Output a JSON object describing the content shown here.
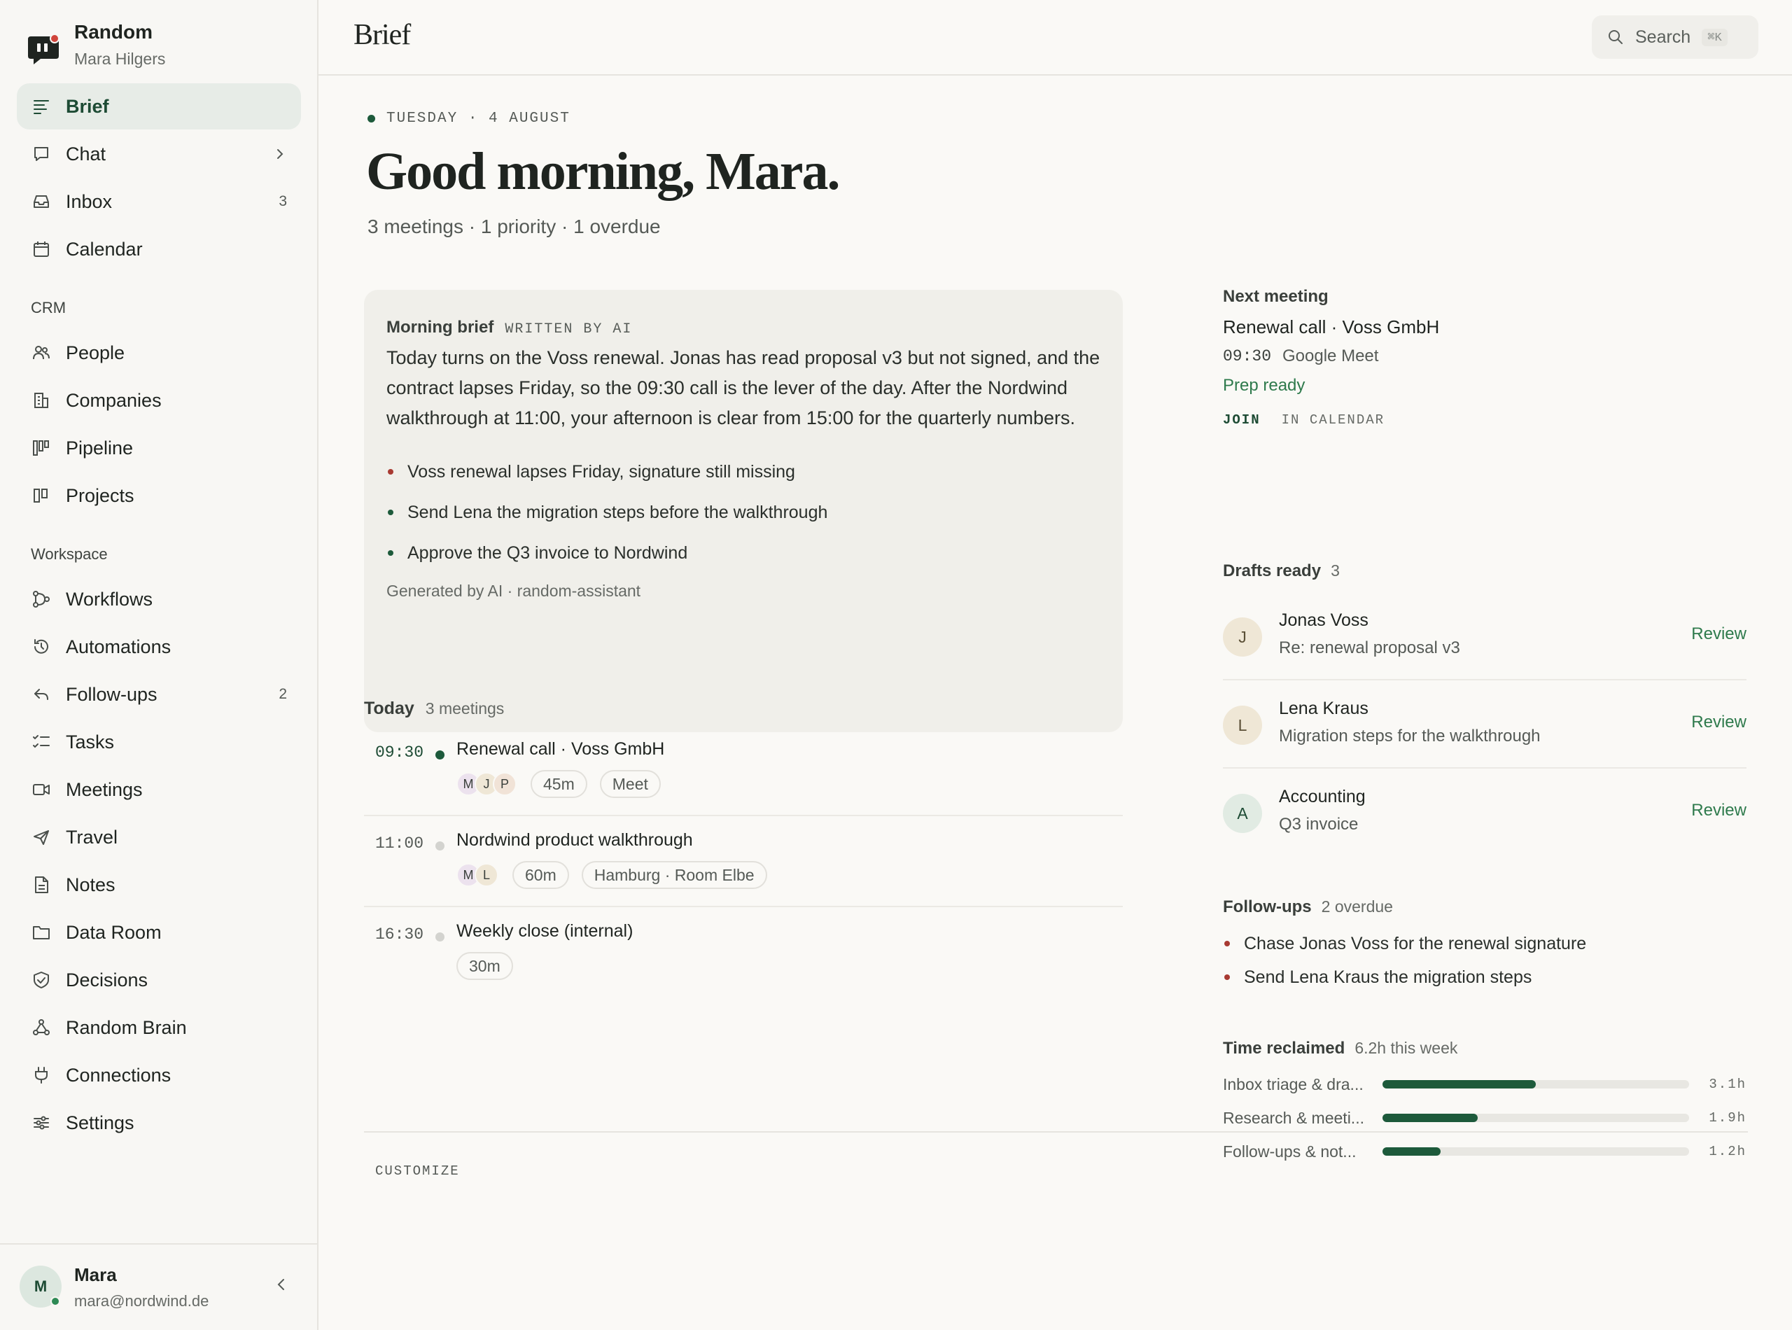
{
  "workspace": {
    "name": "Random",
    "user": "Mara Hilgers"
  },
  "nav": {
    "primary": [
      {
        "label": "Brief",
        "icon": "brief-icon",
        "active": true
      },
      {
        "label": "Chat",
        "icon": "chat-icon",
        "chevron": true
      },
      {
        "label": "Inbox",
        "icon": "inbox-icon",
        "count": "3"
      },
      {
        "label": "Calendar",
        "icon": "calendar-icon"
      }
    ],
    "crm_label": "CRM",
    "crm": [
      {
        "label": "People",
        "icon": "people-icon"
      },
      {
        "label": "Companies",
        "icon": "companies-icon"
      },
      {
        "label": "Pipeline",
        "icon": "pipeline-icon"
      },
      {
        "label": "Projects",
        "icon": "projects-icon"
      }
    ],
    "workspace_label": "Workspace",
    "workspace": [
      {
        "label": "Workflows",
        "icon": "workflows-icon"
      },
      {
        "label": "Automations",
        "icon": "automations-icon"
      },
      {
        "label": "Follow-ups",
        "icon": "follow-ups-icon",
        "count": "2"
      },
      {
        "label": "Tasks",
        "icon": "tasks-icon"
      },
      {
        "label": "Meetings",
        "icon": "meetings-icon"
      },
      {
        "label": "Travel",
        "icon": "travel-icon"
      },
      {
        "label": "Notes",
        "icon": "notes-icon"
      },
      {
        "label": "Data Room",
        "icon": "data-room-icon"
      },
      {
        "label": "Decisions",
        "icon": "decisions-icon"
      },
      {
        "label": "Random Brain",
        "icon": "brain-icon"
      },
      {
        "label": "Connections",
        "icon": "connections-icon"
      },
      {
        "label": "Settings",
        "icon": "settings-icon"
      }
    ]
  },
  "user_bar": {
    "initial": "M",
    "name": "Mara",
    "email": "mara@nordwind.de"
  },
  "header": {
    "title": "Brief",
    "search_label": "Search",
    "search_shortcut": "⌘K"
  },
  "greeting": {
    "dateline": "TUESDAY · 4 AUGUST",
    "title": "Good morning, Mara.",
    "summary": "3 meetings · 1 priority · 1 overdue"
  },
  "brief": {
    "title": "Morning brief",
    "tag": "WRITTEN BY AI",
    "body": "Today turns on the Voss renewal. Jonas has read proposal v3 but not signed, and the contract lapses Friday, so the 09:30 call is the lever of the day. After the Nordwind walkthrough at 11:00, your afternoon is clear from 15:00 for the quarterly numbers.",
    "items": [
      {
        "text": "Voss renewal lapses Friday, signature still missing",
        "color": "#a83a32"
      },
      {
        "text": "Send Lena the migration steps before the walkthrough",
        "color": "#1d5a3b"
      },
      {
        "text": "Approve the Q3 invoice to Nordwind",
        "color": "#1d5a3b"
      }
    ],
    "footer": "Generated by AI · random-assistant"
  },
  "today": {
    "title": "Today",
    "count": "3 meetings",
    "meetings": [
      {
        "time": "09:30",
        "title": "Renewal call · Voss GmbH",
        "attendees": [
          "M",
          "J",
          "P"
        ],
        "duration": "45m",
        "location": "Meet",
        "now": true
      },
      {
        "time": "11:00",
        "title": "Nordwind product walkthrough",
        "attendees": [
          "M",
          "L"
        ],
        "duration": "60m",
        "location": "Hamburg · Room Elbe"
      },
      {
        "time": "16:30",
        "title": "Weekly close (internal)",
        "attendees": [],
        "duration": "30m",
        "location": ""
      }
    ]
  },
  "next_meeting": {
    "heading": "Next meeting",
    "title": "Renewal call · Voss GmbH",
    "time": "09:30",
    "place": "Google Meet",
    "status": "Prep ready",
    "join": "JOIN",
    "calendar": "IN CALENDAR"
  },
  "drafts": {
    "heading": "Drafts ready",
    "count": "3",
    "items": [
      {
        "initial": "J",
        "name": "Jonas Voss",
        "subject": "Re: renewal proposal v3",
        "action": "Review"
      },
      {
        "initial": "L",
        "name": "Lena Kraus",
        "subject": "Migration steps for the walkthrough",
        "action": "Review"
      },
      {
        "initial": "A",
        "name": "Accounting",
        "subject": "Q3 invoice",
        "action": "Review"
      }
    ]
  },
  "followups": {
    "heading": "Follow-ups",
    "count": "2 overdue",
    "items": [
      "Chase Jonas Voss for the renewal signature",
      "Send Lena Kraus the migration steps"
    ]
  },
  "time_reclaimed": {
    "heading": "Time reclaimed",
    "total": "6.2h this week",
    "rows": [
      {
        "label": "Inbox triage & dra...",
        "value": "3.1h",
        "fraction": 0.5
      },
      {
        "label": "Research & meeti...",
        "value": "1.9h",
        "fraction": 0.31
      },
      {
        "label": "Follow-ups & not...",
        "value": "1.2h",
        "fraction": 0.19
      }
    ]
  },
  "customize": "CUSTOMIZE",
  "colors": {
    "accent": "#1d4b34",
    "positive": "#2e7a4c",
    "alert": "#a83a32"
  }
}
